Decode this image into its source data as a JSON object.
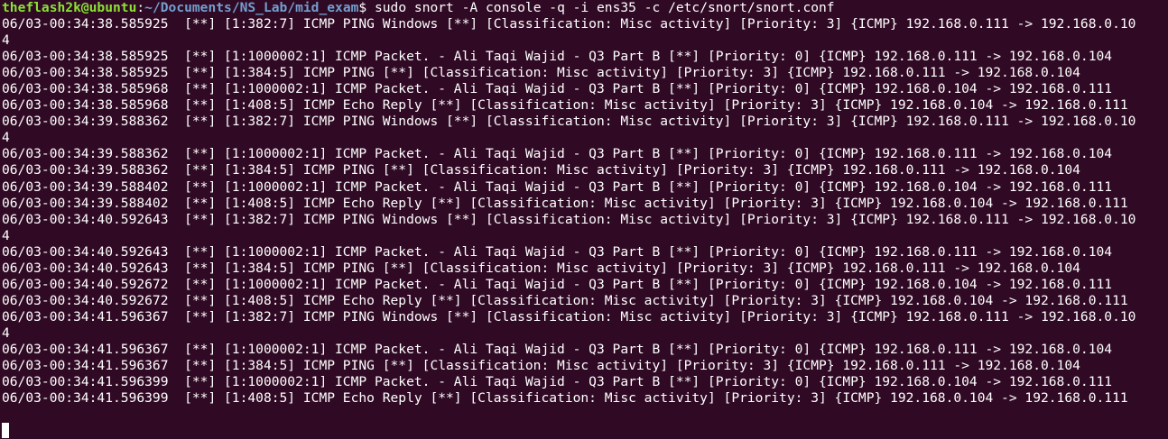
{
  "terminal": {
    "prompt": {
      "user_host": "theflash2k@ubuntu",
      "separator": ":",
      "path": "~/Documents/NS_Lab/mid_exam",
      "dollar": "$ ",
      "command": "sudo snort -A console -q -i ens35 -c /etc/snort/snort.conf"
    },
    "output_lines": [
      "06/03-00:34:38.585925  [**] [1:382:7] ICMP PING Windows [**] [Classification: Misc activity] [Priority: 3] {ICMP} 192.168.0.111 -> 192.168.0.10",
      "4",
      "06/03-00:34:38.585925  [**] [1:1000002:1] ICMP Packet. - Ali Taqi Wajid - Q3 Part B [**] [Priority: 0] {ICMP} 192.168.0.111 -> 192.168.0.104",
      "06/03-00:34:38.585925  [**] [1:384:5] ICMP PING [**] [Classification: Misc activity] [Priority: 3] {ICMP} 192.168.0.111 -> 192.168.0.104",
      "06/03-00:34:38.585968  [**] [1:1000002:1] ICMP Packet. - Ali Taqi Wajid - Q3 Part B [**] [Priority: 0] {ICMP} 192.168.0.104 -> 192.168.0.111",
      "06/03-00:34:38.585968  [**] [1:408:5] ICMP Echo Reply [**] [Classification: Misc activity] [Priority: 3] {ICMP} 192.168.0.104 -> 192.168.0.111",
      "06/03-00:34:39.588362  [**] [1:382:7] ICMP PING Windows [**] [Classification: Misc activity] [Priority: 3] {ICMP} 192.168.0.111 -> 192.168.0.10",
      "4",
      "06/03-00:34:39.588362  [**] [1:1000002:1] ICMP Packet. - Ali Taqi Wajid - Q3 Part B [**] [Priority: 0] {ICMP} 192.168.0.111 -> 192.168.0.104",
      "06/03-00:34:39.588362  [**] [1:384:5] ICMP PING [**] [Classification: Misc activity] [Priority: 3] {ICMP} 192.168.0.111 -> 192.168.0.104",
      "06/03-00:34:39.588402  [**] [1:1000002:1] ICMP Packet. - Ali Taqi Wajid - Q3 Part B [**] [Priority: 0] {ICMP} 192.168.0.104 -> 192.168.0.111",
      "06/03-00:34:39.588402  [**] [1:408:5] ICMP Echo Reply [**] [Classification: Misc activity] [Priority: 3] {ICMP} 192.168.0.104 -> 192.168.0.111",
      "06/03-00:34:40.592643  [**] [1:382:7] ICMP PING Windows [**] [Classification: Misc activity] [Priority: 3] {ICMP} 192.168.0.111 -> 192.168.0.10",
      "4",
      "06/03-00:34:40.592643  [**] [1:1000002:1] ICMP Packet. - Ali Taqi Wajid - Q3 Part B [**] [Priority: 0] {ICMP} 192.168.0.111 -> 192.168.0.104",
      "06/03-00:34:40.592643  [**] [1:384:5] ICMP PING [**] [Classification: Misc activity] [Priority: 3] {ICMP} 192.168.0.111 -> 192.168.0.104",
      "06/03-00:34:40.592672  [**] [1:1000002:1] ICMP Packet. - Ali Taqi Wajid - Q3 Part B [**] [Priority: 0] {ICMP} 192.168.0.104 -> 192.168.0.111",
      "06/03-00:34:40.592672  [**] [1:408:5] ICMP Echo Reply [**] [Classification: Misc activity] [Priority: 3] {ICMP} 192.168.0.104 -> 192.168.0.111",
      "06/03-00:34:41.596367  [**] [1:382:7] ICMP PING Windows [**] [Classification: Misc activity] [Priority: 3] {ICMP} 192.168.0.111 -> 192.168.0.10",
      "4",
      "06/03-00:34:41.596367  [**] [1:1000002:1] ICMP Packet. - Ali Taqi Wajid - Q3 Part B [**] [Priority: 0] {ICMP} 192.168.0.111 -> 192.168.0.104",
      "06/03-00:34:41.596367  [**] [1:384:5] ICMP PING [**] [Classification: Misc activity] [Priority: 3] {ICMP} 192.168.0.111 -> 192.168.0.104",
      "06/03-00:34:41.596399  [**] [1:1000002:1] ICMP Packet. - Ali Taqi Wajid - Q3 Part B [**] [Priority: 0] {ICMP} 192.168.0.104 -> 192.168.0.111",
      "06/03-00:34:41.596399  [**] [1:408:5] ICMP Echo Reply [**] [Classification: Misc activity] [Priority: 3] {ICMP} 192.168.0.104 -> 192.168.0.111"
    ],
    "colors": {
      "background": "#300a24",
      "text": "#ffffff",
      "prompt_user": "#8ae234",
      "prompt_path": "#729fcf"
    }
  }
}
